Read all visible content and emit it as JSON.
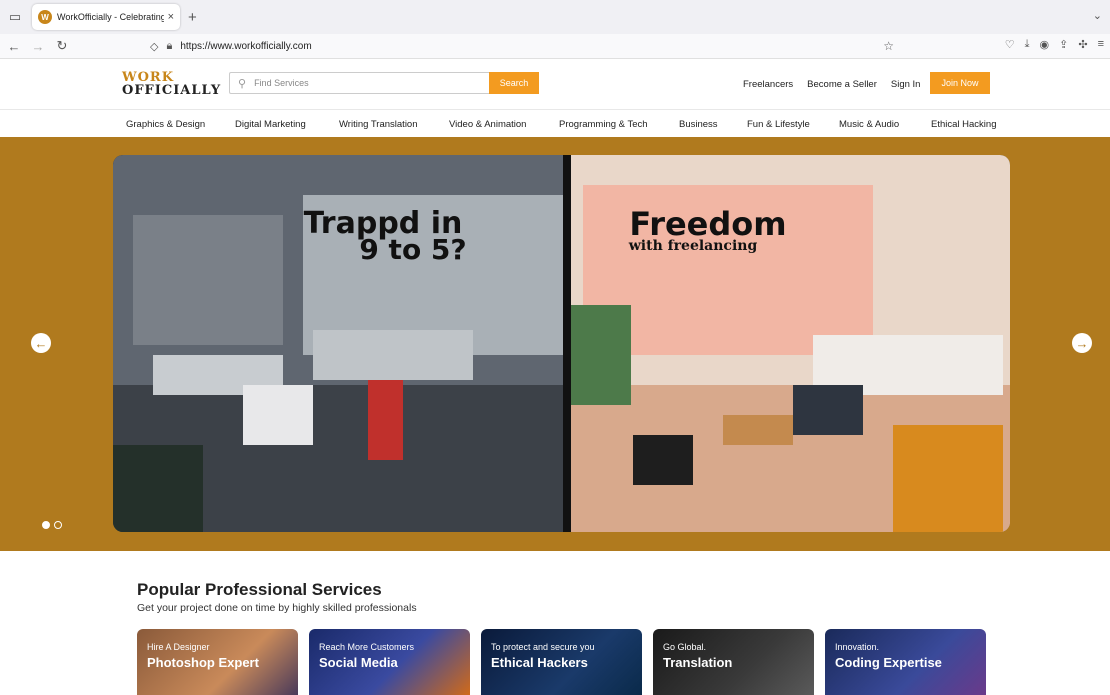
{
  "browser": {
    "tab_title": "WorkOfficially - Celebrating Ev...",
    "tab_close": "×",
    "new_tab": "+",
    "url": "https://www.workofficially.com"
  },
  "site": {
    "logo_line1": "WORK",
    "logo_line2": "OFFICIALLY",
    "search_placeholder": "Find Services",
    "search_button": "Search",
    "header_links": [
      "Freelancers",
      "Become a Seller",
      "Sign In"
    ],
    "join_button": "Join Now",
    "categories": [
      "Graphics & Design",
      "Digital Marketing",
      "Writing Translation",
      "Video & Animation",
      "Programming & Tech",
      "Business",
      "Fun & Lifestyle",
      "Music & Audio",
      "Ethical Hacking"
    ]
  },
  "hero": {
    "left_headline_1": "Trappd in",
    "left_headline_2": "9 to 5?",
    "right_headline": "Freedom",
    "right_subline": "with freelancing",
    "slide_count": 2,
    "active_slide": 1
  },
  "services": {
    "title": "Popular Professional Services",
    "subtitle": "Get your project done on time by highly skilled professionals",
    "cards": [
      {
        "small": "Hire A Designer",
        "big": "Photoshop Expert"
      },
      {
        "small": "Reach More Customers",
        "big": "Social Media"
      },
      {
        "small": "To protect and secure you",
        "big": "Ethical Hackers"
      },
      {
        "small": "Go Global.",
        "big": "Translation"
      },
      {
        "small": "Innovation.",
        "big": "Coding Expertise"
      }
    ]
  },
  "colors": {
    "accent": "#f39b20",
    "hero_bg": "#b07a1e",
    "logo_gold": "#c8861a"
  }
}
